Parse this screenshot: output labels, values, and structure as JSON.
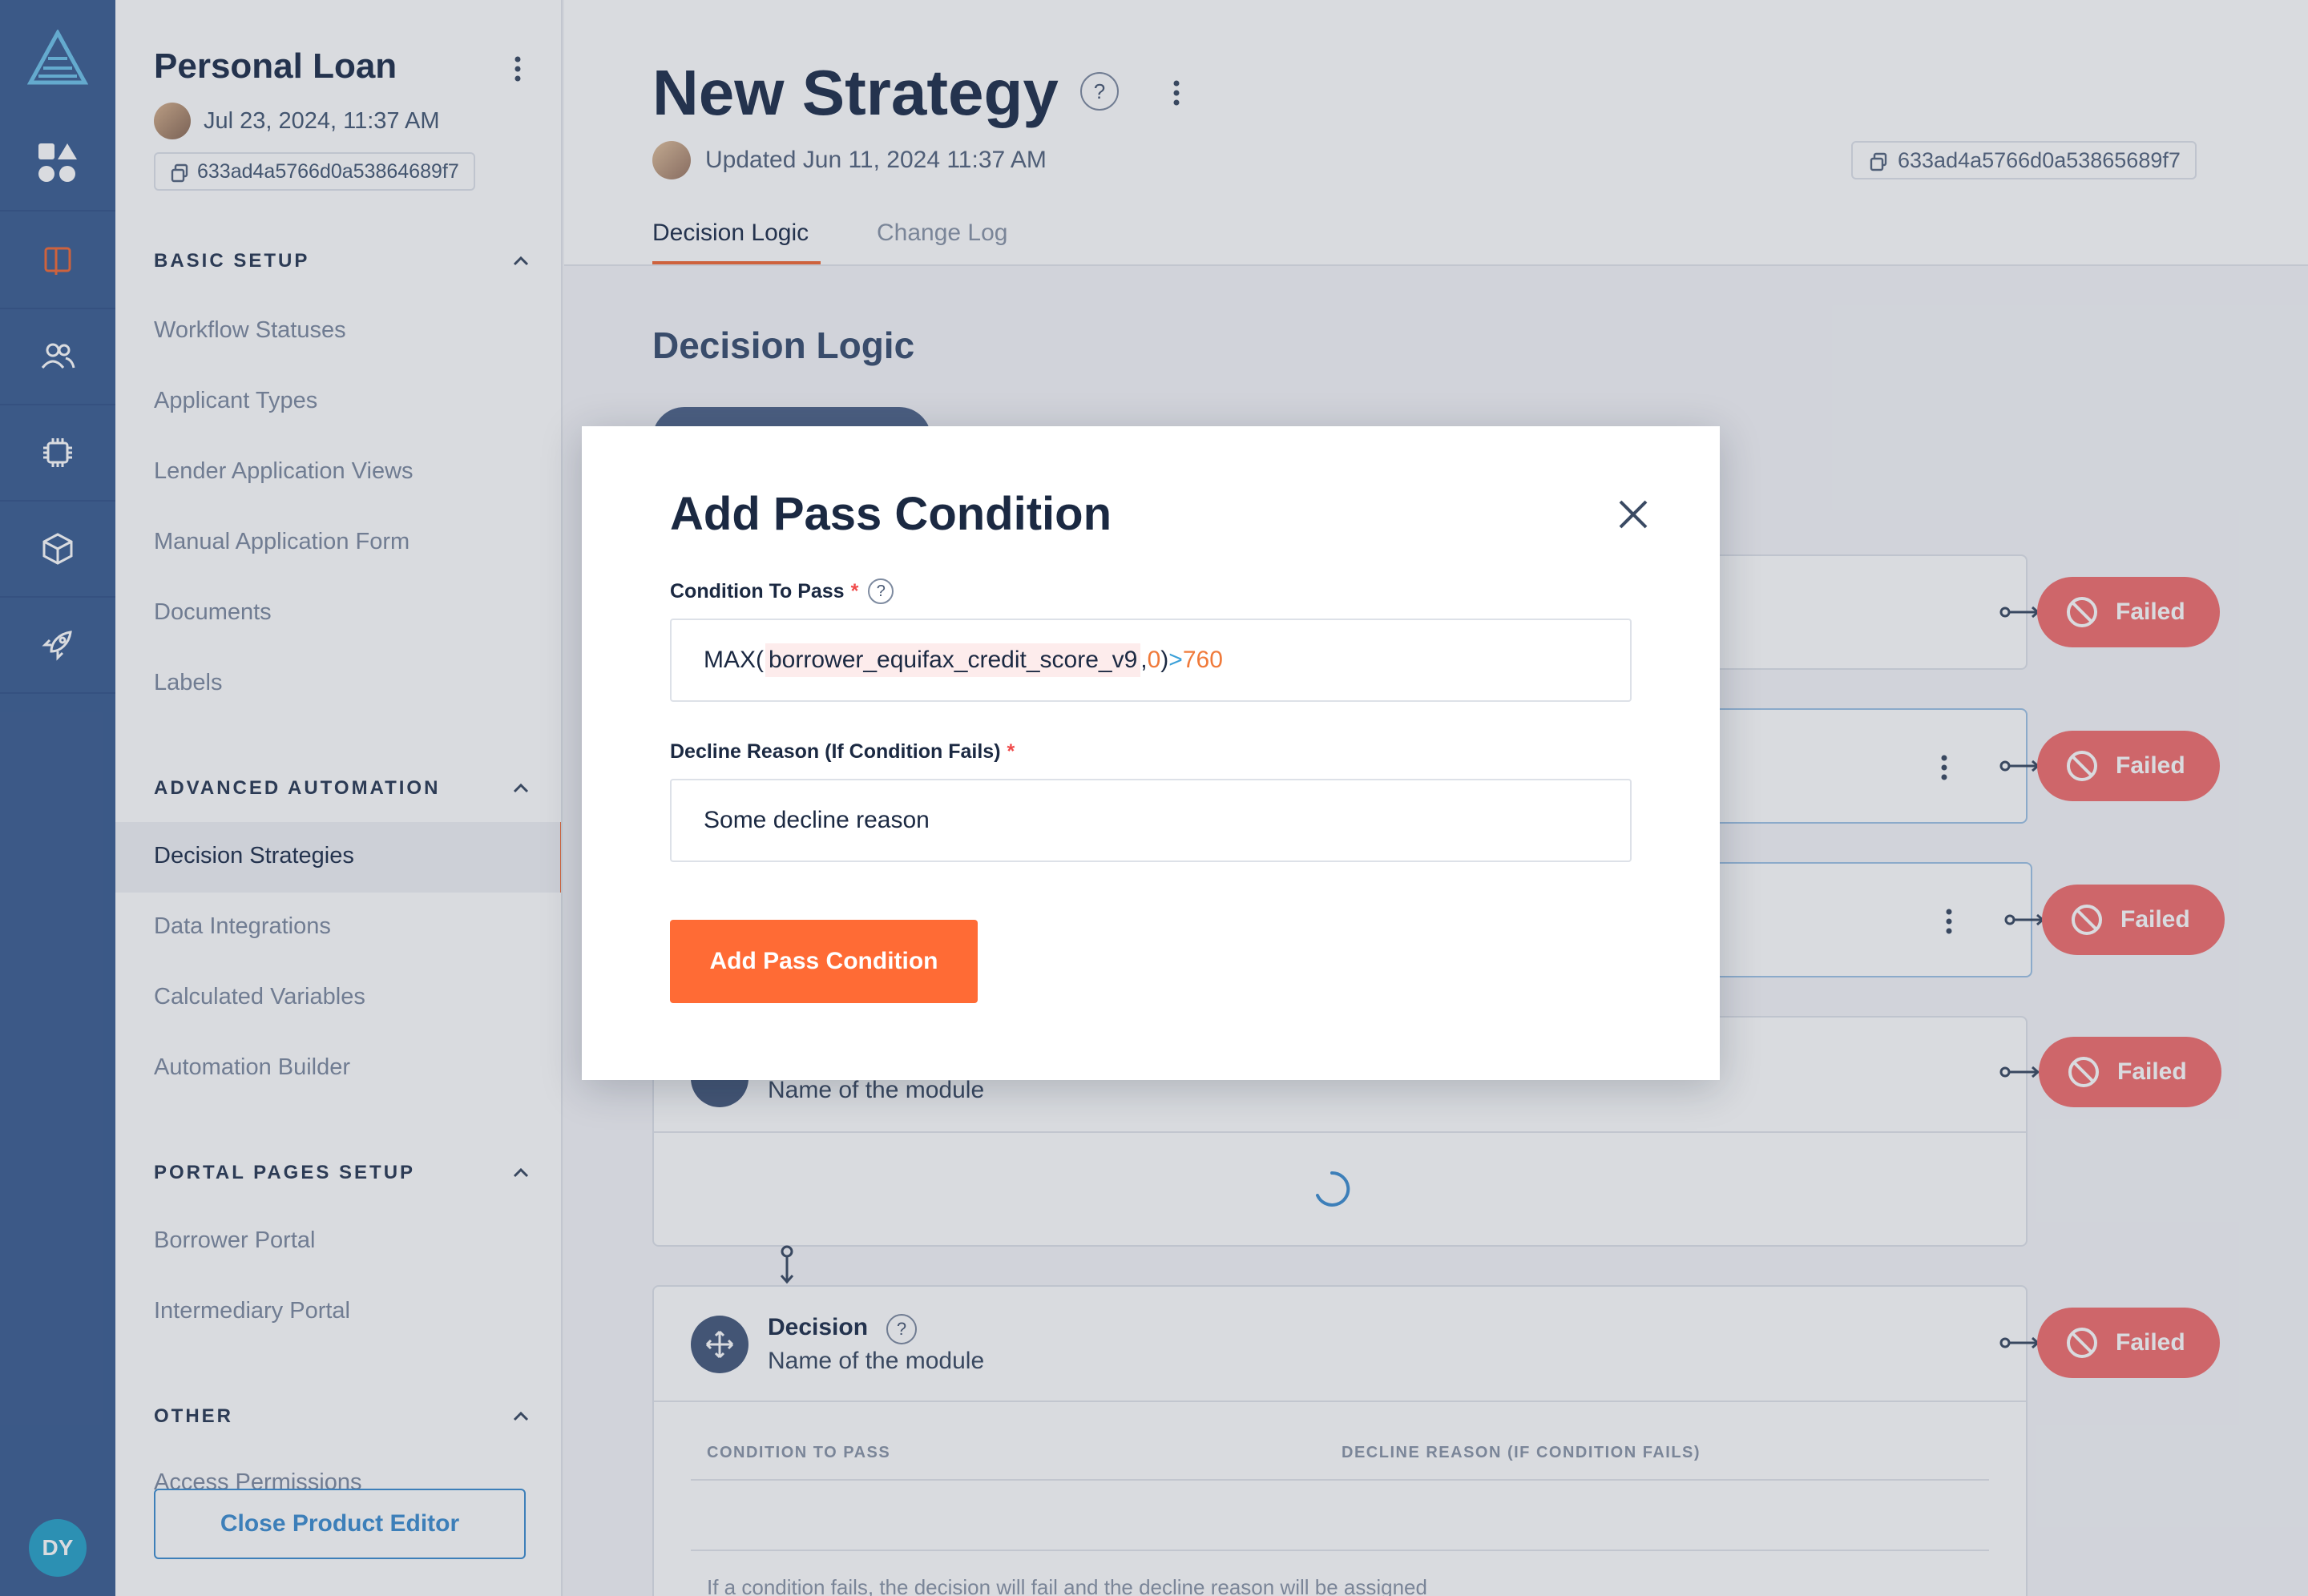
{
  "rail": {
    "avatar_initials": "DY"
  },
  "sidebar": {
    "product_title": "Personal Loan",
    "product_date": "Jul 23, 2024, 11:37 AM",
    "product_id": "633ad4a5766d0a53864689f7",
    "sections": [
      {
        "title": "BASIC SETUP",
        "items": [
          "Workflow Statuses",
          "Applicant Types",
          "Lender Application Views",
          "Manual Application Form",
          "Documents",
          "Labels"
        ]
      },
      {
        "title": "ADVANCED AUTOMATION",
        "items": [
          "Decision Strategies",
          "Data Integrations",
          "Calculated Variables",
          "Automation Builder"
        ]
      },
      {
        "title": "PORTAL PAGES SETUP",
        "items": [
          "Borrower Portal",
          "Intermediary Portal"
        ]
      },
      {
        "title": "OTHER",
        "items": [
          "Access Permissions"
        ]
      }
    ],
    "active_item": "Decision Strategies",
    "close_button": "Close Product Editor"
  },
  "header": {
    "title": "New Strategy",
    "help": "?",
    "updated": "Updated Jun 11, 2024 11:37 AM",
    "strategy_id": "633ad4a5766d0a53865689f7",
    "tabs": [
      "Decision Logic",
      "Change Log"
    ]
  },
  "content": {
    "section_title": "Decision Logic",
    "modules": [
      {
        "type": "",
        "name": "Name of the module"
      },
      {
        "type": "Decision",
        "name": "Name of the module"
      }
    ],
    "status_badge": "Failed",
    "table_headers": [
      "CONDITION TO PASS",
      "DECLINE REASON (IF CONDITION FAILS)"
    ],
    "hint": "If a condition fails, the decision will fail and the decline reason will be assigned"
  },
  "modal": {
    "title": "Add Pass Condition",
    "condition_label": "Condition To Pass",
    "condition_tokens": {
      "fn": "MAX(",
      "var": "borrower_equifax_credit_score_v9",
      "comma": ",",
      "zero": "0",
      "close": ")",
      "op": ">",
      "value": "760"
    },
    "decline_label": "Decline Reason (If Condition Fails)",
    "decline_value": "Some decline reason",
    "required_mark": "*",
    "help": "?",
    "submit_label": "Add Pass Condition"
  },
  "colors": {
    "rail": "#3d5f93",
    "accent": "#ff6b35",
    "failed": "#f26f6f",
    "link": "#3f8ed0"
  },
  "icons": [
    "logo-icon",
    "apps-icon",
    "book-icon",
    "users-icon",
    "chip-icon",
    "cube-icon",
    "rocket-icon",
    "copy-icon",
    "kebab-icon",
    "chevron-up-icon",
    "close-icon",
    "block-icon",
    "decision-icon",
    "spinner-icon"
  ]
}
